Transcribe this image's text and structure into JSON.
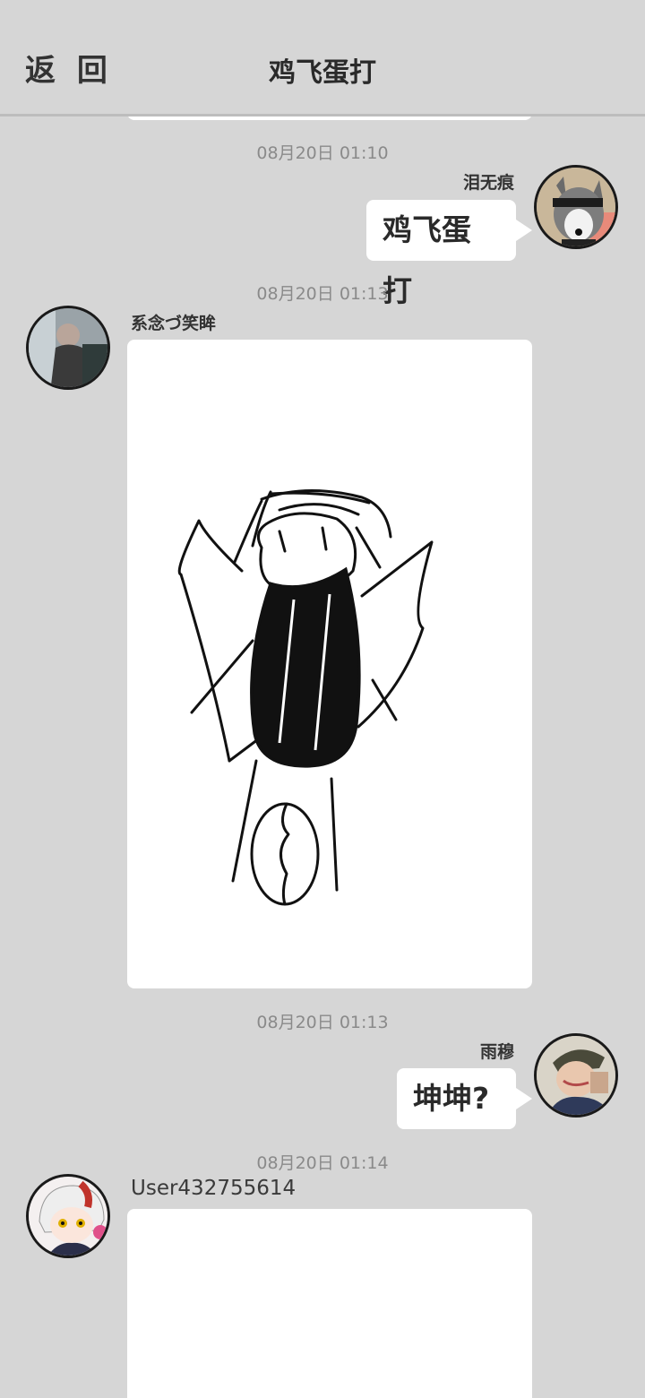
{
  "header": {
    "back_label": "返 回",
    "title": "鸡飞蛋打"
  },
  "messages": [
    {
      "time": "08月20日  01:10",
      "sender": "泪无痕",
      "side": "right",
      "text": "鸡飞蛋打",
      "avatar": "husky-avatar"
    },
    {
      "time": "08月20日  01:13",
      "sender": "系念づ笑眸",
      "side": "left",
      "image": "stick-figure-drawing",
      "avatar": "man-photo-avatar"
    },
    {
      "time": "08月20日  01:13",
      "sender": "雨穆",
      "side": "right",
      "text": "坤坤?",
      "avatar": "anime-man-avatar"
    },
    {
      "time": "08月20日  01:14",
      "sender": "User432755614",
      "side": "left",
      "image": "blank-drawing",
      "avatar": "anime-girl-avatar"
    }
  ]
}
